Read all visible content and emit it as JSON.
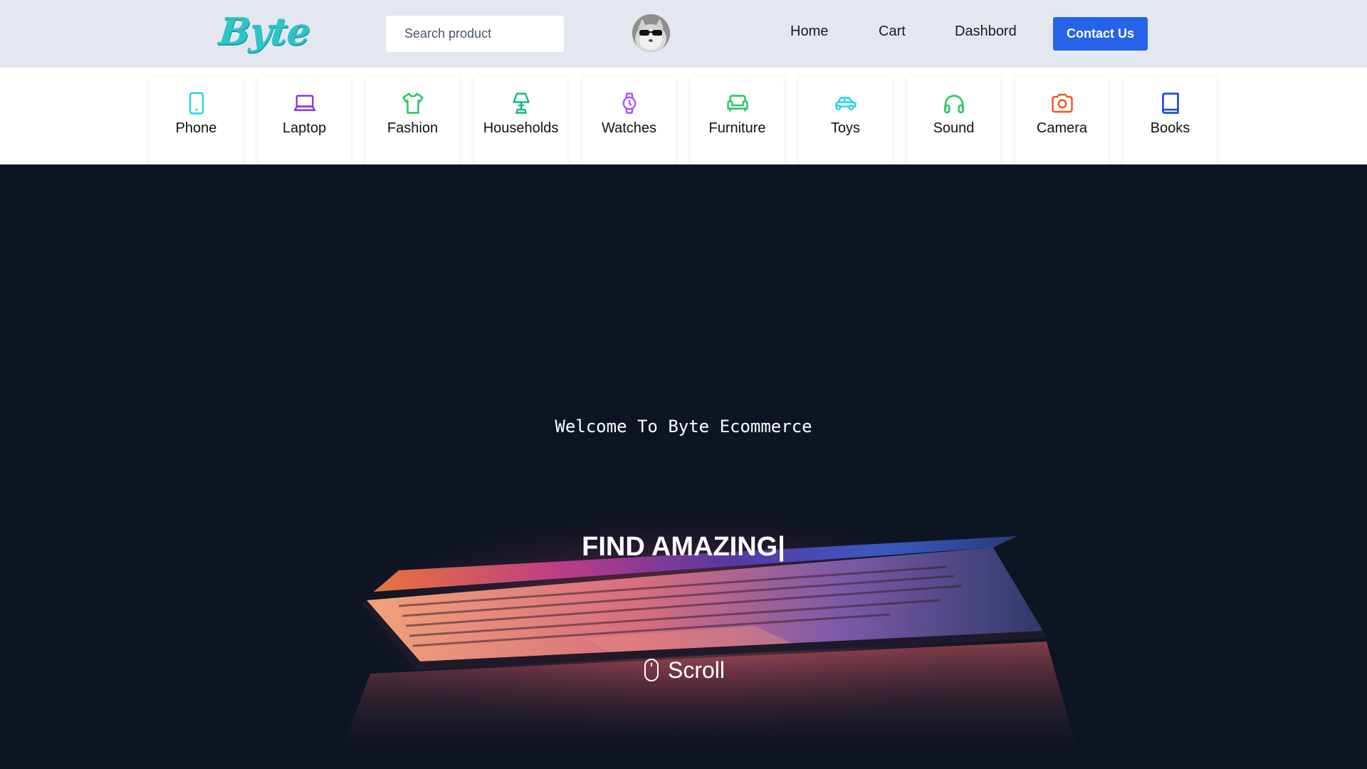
{
  "header": {
    "logo": "Byte",
    "search_placeholder": "Search product",
    "nav": {
      "home": "Home",
      "cart": "Cart",
      "dashboard": "Dashbord"
    },
    "contact_label": "Contact Us"
  },
  "categories": [
    {
      "label": "Phone",
      "icon": "phone-icon",
      "color": "#22d3ee"
    },
    {
      "label": "Laptop",
      "icon": "laptop-icon",
      "color": "#9333ea"
    },
    {
      "label": "Fashion",
      "icon": "shirt-icon",
      "color": "#22c55e"
    },
    {
      "label": "Households",
      "icon": "lamp-icon",
      "color": "#10b981"
    },
    {
      "label": "Watches",
      "icon": "watch-icon",
      "color": "#a855f7"
    },
    {
      "label": "Furniture",
      "icon": "sofa-icon",
      "color": "#22c55e"
    },
    {
      "label": "Toys",
      "icon": "toy-car-icon",
      "color": "#22d3ee"
    },
    {
      "label": "Sound",
      "icon": "headphones-icon",
      "color": "#22c55e"
    },
    {
      "label": "Camera",
      "icon": "camera-icon",
      "color": "#f4511e"
    },
    {
      "label": "Books",
      "icon": "book-icon",
      "color": "#1d4ed8"
    }
  ],
  "hero": {
    "welcome": "Welcome To Byte Ecommerce",
    "headline": "FIND AMAZING|",
    "scroll_label": "Scroll"
  },
  "colors": {
    "header_bg": "#e3e8f0",
    "accent": "#2563eb",
    "logo": "#2ec4c7",
    "hero_bg": "#0d1422"
  }
}
